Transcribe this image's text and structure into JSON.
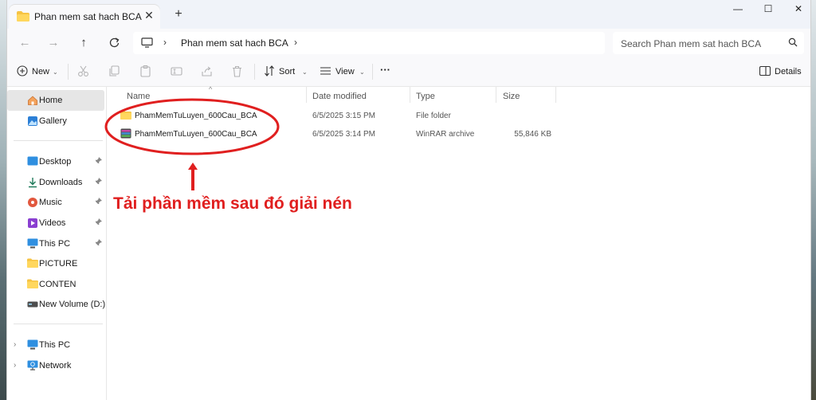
{
  "window": {
    "tab_title": "Phan mem sat hach BCA",
    "new_tab": "+",
    "tab_close": "✕",
    "min": "—",
    "max": "☐",
    "close": "✕"
  },
  "address": {
    "crumb": "Phan mem sat hach BCA",
    "sep": "›",
    "search_placeholder": "Search Phan mem sat hach BCA"
  },
  "toolbar": {
    "new_label": "New",
    "sort_label": "Sort",
    "view_label": "View",
    "more_label": "···",
    "details_label": "Details",
    "caret": "⌄"
  },
  "sidebar": {
    "top": [
      {
        "label": "Home",
        "icon": "home-icon"
      },
      {
        "label": "Gallery",
        "icon": "gallery-icon"
      }
    ],
    "quick": [
      {
        "label": "Desktop",
        "icon": "desktop-icon",
        "pinned": true
      },
      {
        "label": "Downloads",
        "icon": "download-icon",
        "pinned": true
      },
      {
        "label": "Music",
        "icon": "music-icon",
        "pinned": true
      },
      {
        "label": "Videos",
        "icon": "videos-icon",
        "pinned": true
      },
      {
        "label": "This PC",
        "icon": "pc-icon",
        "pinned": true
      },
      {
        "label": "PICTURE",
        "icon": "folder-icon",
        "pinned": false
      },
      {
        "label": "CONTEN",
        "icon": "folder-icon",
        "pinned": false
      },
      {
        "label": "New Volume (D:)",
        "icon": "drive-icon",
        "pinned": false
      }
    ],
    "bottom": [
      {
        "label": "This PC",
        "icon": "pc-icon"
      },
      {
        "label": "Network",
        "icon": "network-icon"
      }
    ],
    "pin_glyph": "📌",
    "chevron": "›"
  },
  "list": {
    "headers": {
      "name": "Name",
      "date": "Date modified",
      "type": "Type",
      "size": "Size"
    },
    "rows": [
      {
        "name": "PhamMemTuLuyen_600Cau_BCA",
        "date": "6/5/2025 3:15 PM",
        "type": "File folder",
        "size": "",
        "icon": "folder-icon"
      },
      {
        "name": "PhamMemTuLuyen_600Cau_BCA",
        "date": "6/5/2025 3:14 PM",
        "type": "WinRAR archive",
        "size": "55,846 KB",
        "icon": "winrar-icon"
      }
    ]
  },
  "annotation": {
    "text": "Tải phần mềm sau đó giải nén",
    "color": "#e01f1f"
  }
}
